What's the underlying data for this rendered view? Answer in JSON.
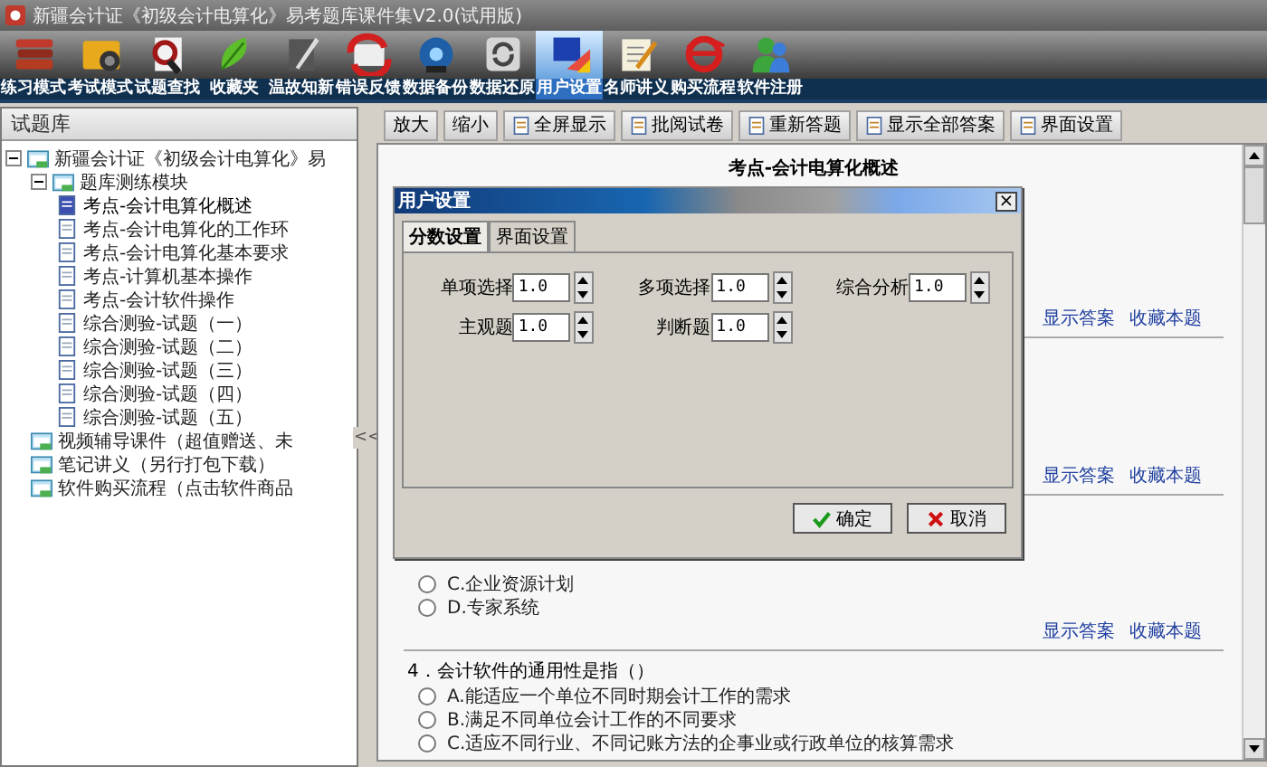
{
  "window": {
    "title": "新疆会计证《初级会计电算化》易考题库课件集V2.0(试用版)"
  },
  "toolbar": [
    {
      "label": "练习模式",
      "selected": false
    },
    {
      "label": "考试模式",
      "selected": false
    },
    {
      "label": "试题查找",
      "selected": false
    },
    {
      "label": "收藏夹",
      "selected": false
    },
    {
      "label": "温故知新",
      "selected": false
    },
    {
      "label": "错误反馈",
      "selected": false
    },
    {
      "label": "数据备份",
      "selected": false
    },
    {
      "label": "数据还原",
      "selected": false
    },
    {
      "label": "用户设置",
      "selected": true
    },
    {
      "label": "名师讲义",
      "selected": false
    },
    {
      "label": "购买流程",
      "selected": false
    },
    {
      "label": "软件注册",
      "selected": false
    }
  ],
  "sidebar": {
    "title": "试题库",
    "splitter": "<<",
    "tree": [
      {
        "label": "新疆会计证《初级会计电算化》易",
        "expanded": true,
        "children": [
          {
            "label": "题库测练模块",
            "expanded": true,
            "children": [
              {
                "label": "考点-会计电算化概述",
                "selected": true
              },
              {
                "label": "考点-会计电算化的工作环",
                "selected": false
              },
              {
                "label": "考点-会计电算化基本要求",
                "selected": false
              },
              {
                "label": "考点-计算机基本操作",
                "selected": false
              },
              {
                "label": "考点-会计软件操作",
                "selected": false
              },
              {
                "label": "综合测验-试题（一）",
                "selected": false
              },
              {
                "label": "综合测验-试题（二）",
                "selected": false
              },
              {
                "label": "综合测验-试题（三）",
                "selected": false
              },
              {
                "label": "综合测验-试题（四）",
                "selected": false
              },
              {
                "label": "综合测验-试题（五）",
                "selected": false
              }
            ]
          },
          {
            "label": "视频辅导课件（超值赠送、未"
          },
          {
            "label": "笔记讲义（另行打包下载）"
          },
          {
            "label": "软件购买流程（点击软件商品"
          }
        ]
      }
    ]
  },
  "content_toolbar": [
    {
      "label": "放大",
      "icon": false
    },
    {
      "label": "缩小",
      "icon": false
    },
    {
      "label": "全屏显示",
      "icon": true
    },
    {
      "label": "批阅试卷",
      "icon": true
    },
    {
      "label": "重新答题",
      "icon": true
    },
    {
      "label": "显示全部答案",
      "icon": true
    },
    {
      "label": "界面设置",
      "icon": true
    }
  ],
  "document": {
    "title": "考点-会计电算化概述",
    "sections": [
      {
        "kind": "hidden",
        "links": [
          "显示答案",
          "收藏本题"
        ]
      },
      {
        "kind": "hidden",
        "links": [
          "显示答案",
          "收藏本题"
        ]
      },
      {
        "kind": "options",
        "options": [
          {
            "text": "C.企业资源计划",
            "selected": false
          },
          {
            "text": "D.专家系统",
            "selected": false
          }
        ],
        "links": [
          "显示答案",
          "收藏本题"
        ]
      },
      {
        "kind": "question",
        "question": "4．会计软件的通用性是指（）",
        "options": [
          {
            "text": "A.能适应一个单位不同时期会计工作的需求",
            "selected": false
          },
          {
            "text": "B.满足不同单位会计工作的不同要求",
            "selected": false
          },
          {
            "text": "C.适应不同行业、不同记账方法的企事业或行政单位的核算需求",
            "selected": false
          }
        ]
      }
    ]
  },
  "dialog": {
    "title": "用户设置",
    "close": "×",
    "tabs": [
      {
        "label": "分数设置",
        "selected": true
      },
      {
        "label": "界面设置",
        "selected": false
      }
    ],
    "fields": [
      {
        "label": "单项选择",
        "value": "1.0"
      },
      {
        "label": "多项选择",
        "value": "1.0"
      },
      {
        "label": "综合分析",
        "value": "1.0"
      },
      {
        "label": "主观题",
        "value": "1.0"
      },
      {
        "label": "判断题",
        "value": "1.0"
      }
    ],
    "buttons": [
      {
        "kind": "ok",
        "label": "确定"
      },
      {
        "kind": "cancel",
        "label": "取消"
      }
    ]
  }
}
